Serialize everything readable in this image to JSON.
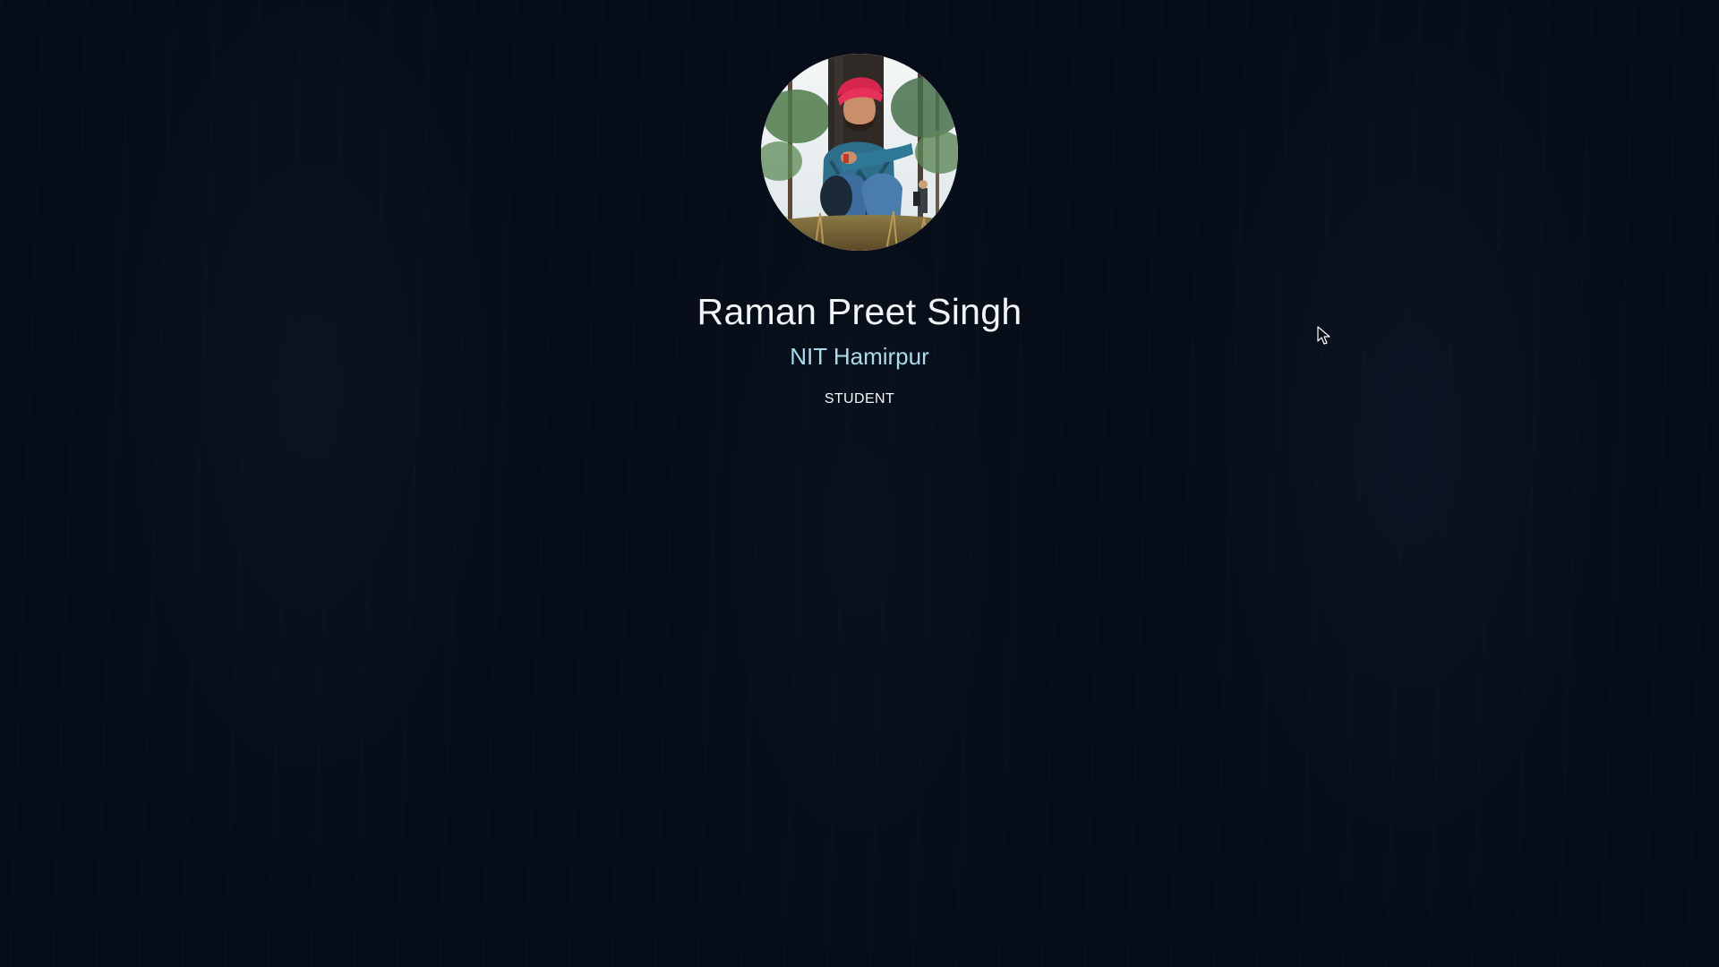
{
  "profile": {
    "avatar_icon": "profile-photo",
    "name": "Raman Preet Singh",
    "institute": "NIT Hamirpur",
    "role": "STUDENT"
  },
  "colors": {
    "background": "#050c17",
    "name_text": "#f2f4f7",
    "institute_text": "#a9dcea",
    "role_text": "#f4f6f8"
  },
  "cursor": {
    "icon": "mouse-pointer-icon"
  }
}
